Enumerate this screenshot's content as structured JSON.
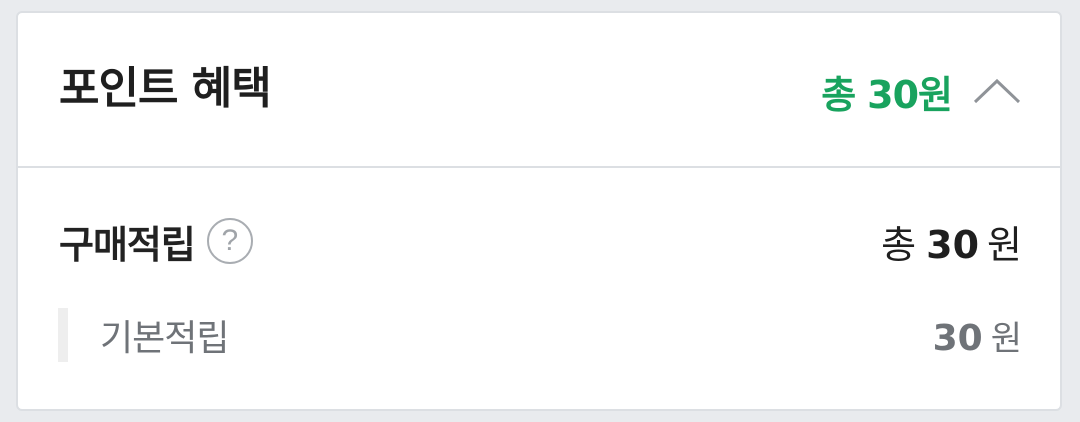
{
  "header": {
    "title": "포인트 혜택",
    "total_prefix": "총",
    "total_value": "30원",
    "icons": {
      "collapse": "chevron-up-icon"
    }
  },
  "purchase_reward": {
    "label": "구매적립",
    "help_icon_glyph": "?",
    "total_prefix": "총",
    "total_value": "30",
    "unit": "원",
    "items": [
      {
        "label": "기본적립",
        "value": "30",
        "unit": "원"
      }
    ]
  },
  "colors": {
    "accent_green": "#19a35e",
    "text_dark": "#1f1f1f",
    "text_gray": "#6f7378",
    "border": "#dcdfe3"
  }
}
